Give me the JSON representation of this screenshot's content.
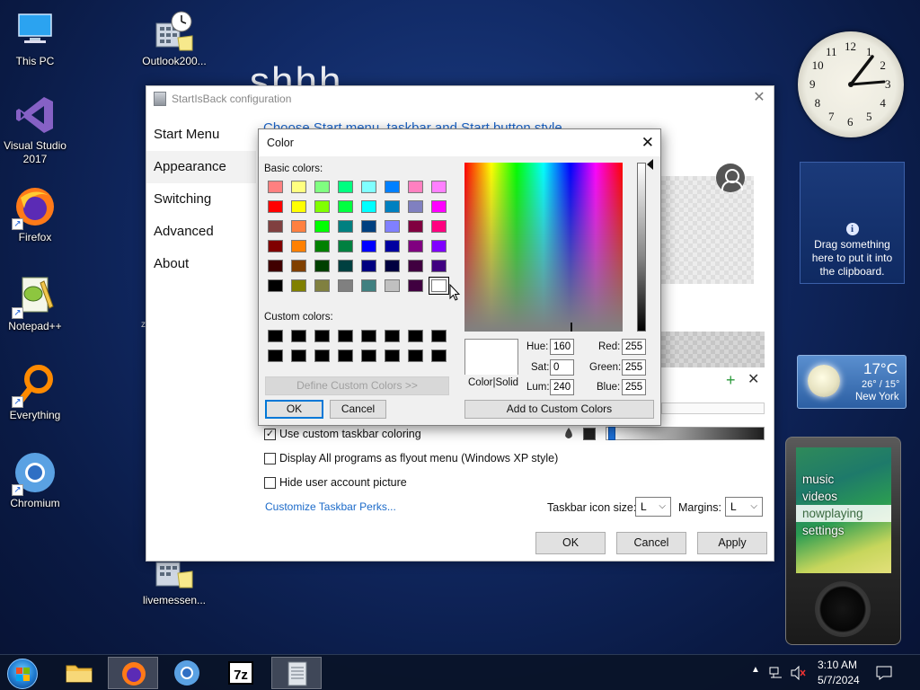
{
  "desktop": {
    "icons": [
      {
        "label": "This PC"
      },
      {
        "label": "Visual Studio 2017"
      },
      {
        "label": "Firefox"
      },
      {
        "label": "Notepad++"
      },
      {
        "label": "Everything"
      },
      {
        "label": "Chromium"
      },
      {
        "label": "Outlook200..."
      },
      {
        "label": "livemessen..."
      }
    ],
    "background_text": "shhh",
    "stray_char": "z"
  },
  "sib": {
    "title": "StartIsBack configuration",
    "nav": [
      "Start Menu",
      "Appearance",
      "Switching",
      "Advanced",
      "About"
    ],
    "heading": "Choose Start menu, taskbar and Start button style",
    "checks": [
      {
        "label": "Use custom taskbar coloring",
        "checked": true
      },
      {
        "label": "Display All programs as flyout menu (Windows XP style)",
        "checked": false
      },
      {
        "label": "Hide user account picture",
        "checked": false
      }
    ],
    "link": "Customize Taskbar Perks...",
    "icon_size_label": "Taskbar icon size:",
    "icon_size_value": "L",
    "margins_label": "Margins:",
    "margins_value": "L",
    "buttons": {
      "ok": "OK",
      "cancel": "Cancel",
      "apply": "Apply"
    }
  },
  "color_dialog": {
    "title": "Color",
    "basic_label": "Basic colors:",
    "custom_label": "Custom colors:",
    "basic_colors": [
      [
        "#ff8080",
        "#ffff80",
        "#80ff80",
        "#00ff80",
        "#80ffff",
        "#0080ff",
        "#ff80c0",
        "#ff80ff"
      ],
      [
        "#ff0000",
        "#ffff00",
        "#80ff00",
        "#00ff40",
        "#00ffff",
        "#0080c0",
        "#8080c0",
        "#ff00ff"
      ],
      [
        "#804040",
        "#ff8040",
        "#00ff00",
        "#008080",
        "#004080",
        "#8080ff",
        "#800040",
        "#ff0080"
      ],
      [
        "#800000",
        "#ff8000",
        "#008000",
        "#008040",
        "#0000ff",
        "#0000a0",
        "#800080",
        "#8000ff"
      ],
      [
        "#400000",
        "#804000",
        "#004000",
        "#004040",
        "#000080",
        "#000040",
        "#400040",
        "#400080"
      ],
      [
        "#000000",
        "#808000",
        "#808040",
        "#808080",
        "#408080",
        "#c0c0c0",
        "#400040",
        "#ffffff"
      ]
    ],
    "selected_basic": "#ffffff",
    "custom_count": 16,
    "define_btn": "Define Custom Colors >>",
    "ok": "OK",
    "cancel": "Cancel",
    "add_btn": "Add to Custom Colors",
    "color_solid": "Color|Solid",
    "hue_label": "Hue:",
    "hue": "160",
    "sat_label": "Sat:",
    "sat": "0",
    "lum_label": "Lum:",
    "lum": "240",
    "red_label": "Red:",
    "red": "255",
    "green_label": "Green:",
    "green": "255",
    "blue_label": "Blue:",
    "blue": "255"
  },
  "gadgets": {
    "clipboard_text": "Drag something here to put it into the clipboard.",
    "clipboard_icon": "i",
    "weather_temp": "17°C",
    "weather_range": "26° / 15°",
    "weather_city": "New York",
    "clock_numbers": [
      "12",
      "1",
      "2",
      "3",
      "4",
      "5",
      "6",
      "7",
      "8",
      "9",
      "10",
      "11"
    ],
    "zune_menu": [
      "music",
      "videos",
      "nowplaying",
      "settings"
    ],
    "zune_highlight": "nowplaying"
  },
  "taskbar": {
    "time": "3:10 AM",
    "date": "5/7/2024",
    "apps": [
      "Explorer",
      "Firefox",
      "Chromium",
      "7-Zip",
      "Notepad"
    ],
    "active_app": "Notepad"
  },
  "colors": {
    "link": "#1a63c7",
    "accent": "#0078d7"
  }
}
